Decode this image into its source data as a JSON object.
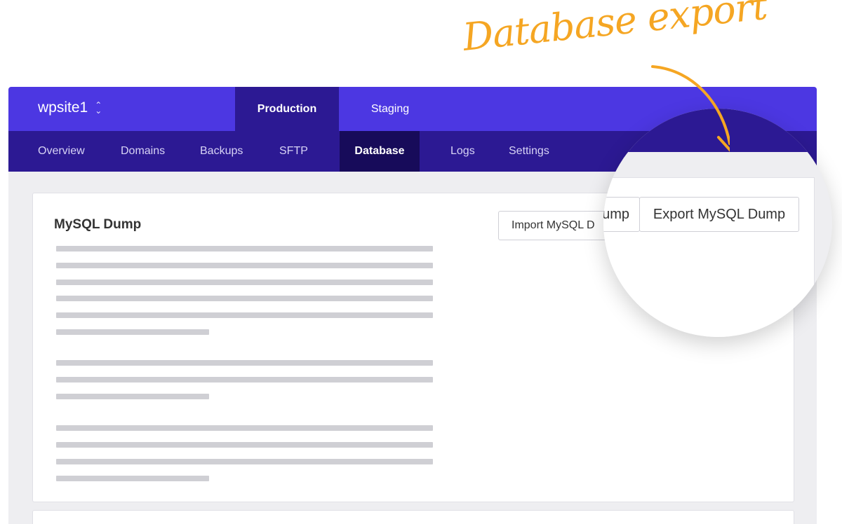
{
  "annotation": {
    "text": "Database export",
    "color": "#f5a623"
  },
  "site": {
    "name": "wpsite1",
    "switcher_icon": "chevron-updown-icon"
  },
  "env_tabs": [
    {
      "label": "Production",
      "active": true
    },
    {
      "label": "Staging",
      "active": false
    }
  ],
  "subnav": [
    {
      "label": "Overview"
    },
    {
      "label": "Domains"
    },
    {
      "label": "Backups"
    },
    {
      "label": "SFTP"
    },
    {
      "label": "Database",
      "active": true
    },
    {
      "label": "Logs"
    },
    {
      "label": "Settings"
    }
  ],
  "card": {
    "title": "MySQL Dump",
    "import_button": "Import MySQL Dump",
    "import_button_visible": "Import MySQL D",
    "export_button": "Export MySQL Dump",
    "magnified_partial": "ump"
  },
  "colors": {
    "brand": "#4c37e2",
    "brand_dark": "#2c1993",
    "active_nav": "#170b5a",
    "accent": "#f5a623"
  }
}
